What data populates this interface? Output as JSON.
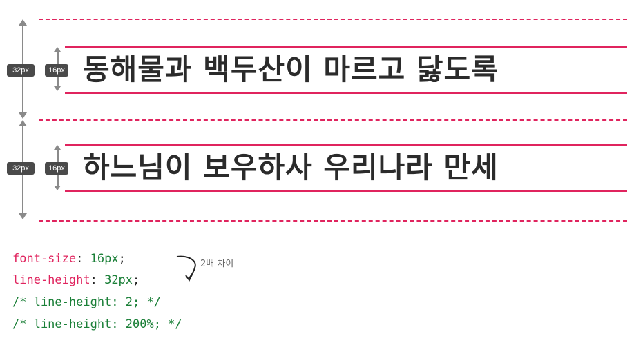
{
  "rows": [
    {
      "label_outer": "32px",
      "label_inner": "16px",
      "text": "동해물과 백두산이 마르고 닳도록"
    },
    {
      "label_outer": "32px",
      "label_inner": "16px",
      "text": "하느님이 보우하사 우리나라 만세"
    }
  ],
  "code": {
    "font_size_prop": "font-size",
    "font_size_value": "16px",
    "line_height_prop": "line-height",
    "line_height_value": "32px",
    "comment1": "/* line-height: 2; */",
    "comment2": "/* line-height: 200%; */"
  },
  "annotation": "2배 차이",
  "colors": {
    "accent": "#e0245e",
    "green": "#1a7f37",
    "arrow": "#8a8a8a",
    "badge": "#4a4a4a"
  }
}
